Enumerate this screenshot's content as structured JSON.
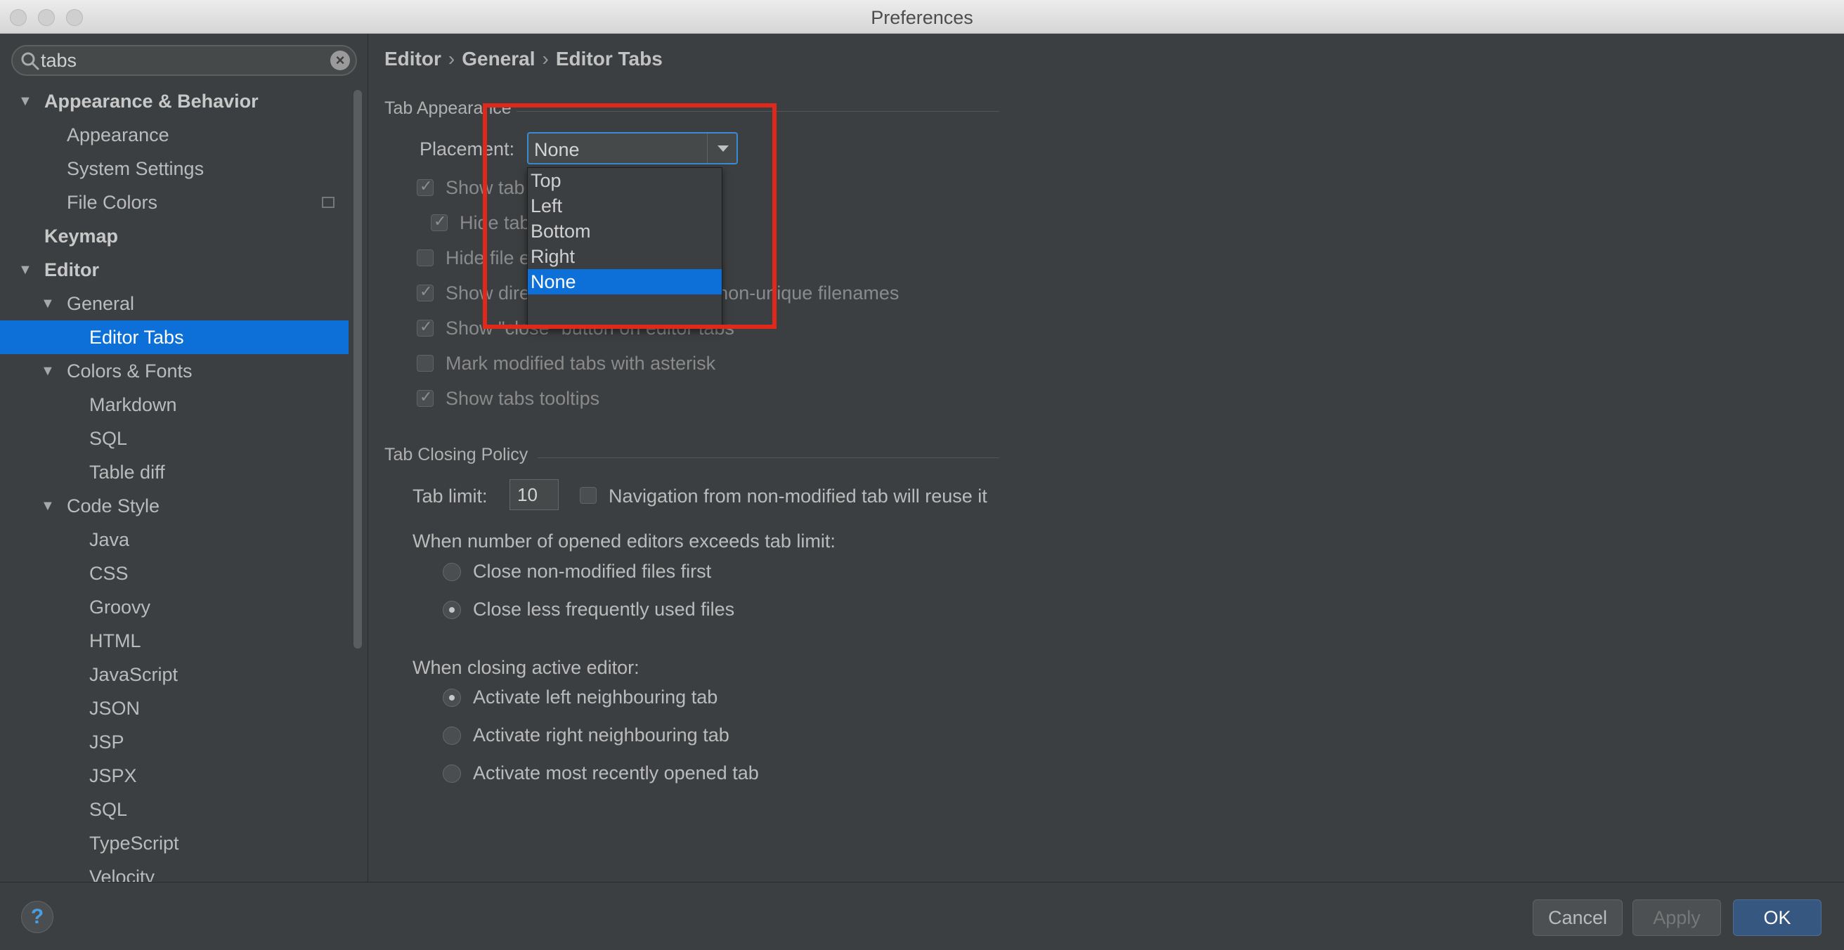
{
  "window": {
    "title": "Preferences"
  },
  "search": {
    "value": "tabs",
    "placeholder": ""
  },
  "sidebar": {
    "items": [
      {
        "label": "Appearance & Behavior",
        "level": 0,
        "bold": true,
        "expanded": true
      },
      {
        "label": "Appearance",
        "level": 1
      },
      {
        "label": "System Settings",
        "level": 1
      },
      {
        "label": "File Colors",
        "level": 1,
        "has_copy_icon": true
      },
      {
        "label": "Keymap",
        "level": 0,
        "bold": true
      },
      {
        "label": "Editor",
        "level": 0,
        "bold": true,
        "expanded": true
      },
      {
        "label": "General",
        "level": 1,
        "expanded": true
      },
      {
        "label": "Editor Tabs",
        "level": 2,
        "selected": true
      },
      {
        "label": "Colors & Fonts",
        "level": 1,
        "expanded": true
      },
      {
        "label": "Markdown",
        "level": 2
      },
      {
        "label": "SQL",
        "level": 2
      },
      {
        "label": "Table diff",
        "level": 2
      },
      {
        "label": "Code Style",
        "level": 1,
        "expanded": true
      },
      {
        "label": "Java",
        "level": 2
      },
      {
        "label": "CSS",
        "level": 2
      },
      {
        "label": "Groovy",
        "level": 2
      },
      {
        "label": "HTML",
        "level": 2
      },
      {
        "label": "JavaScript",
        "level": 2
      },
      {
        "label": "JSON",
        "level": 2
      },
      {
        "label": "JSP",
        "level": 2
      },
      {
        "label": "JSPX",
        "level": 2
      },
      {
        "label": "SQL",
        "level": 2
      },
      {
        "label": "TypeScript",
        "level": 2
      },
      {
        "label": "Velocity",
        "level": 2
      }
    ]
  },
  "breadcrumb": {
    "part1": "Editor",
    "part2": "General",
    "part3": "Editor Tabs",
    "separator": "›"
  },
  "tab_appearance": {
    "title": "Tab Appearance",
    "placement_label": "Placement:",
    "placement_value": "None",
    "placement_options": [
      "Top",
      "Left",
      "Bottom",
      "Right",
      "None"
    ],
    "checkboxes": {
      "show_tabs": {
        "label": "Show tab",
        "checked": true
      },
      "hide_tabs": {
        "label": "Hide tab",
        "checked": true
      },
      "hide_ext": {
        "label": "Hide file e",
        "checked": false
      },
      "show_dir": {
        "label": "Show directory in editor tabs for non-unique filenames",
        "checked": true
      },
      "show_close": {
        "label": "Show \"close\" button on editor tabs",
        "checked": true
      },
      "mark_modified": {
        "label": "Mark modified tabs with asterisk",
        "checked": false
      },
      "show_tooltips": {
        "label": "Show tabs tooltips",
        "checked": true
      }
    }
  },
  "tab_closing": {
    "title": "Tab Closing Policy",
    "tab_limit_label": "Tab limit:",
    "tab_limit_value": "10",
    "reuse_label": "Navigation from non-modified tab will reuse it",
    "exceeds_label": "When number of opened editors exceeds tab limit:",
    "close_non_modified": "Close non-modified files first",
    "close_less_frequent": "Close less frequently used files",
    "closing_active_label": "When closing active editor:",
    "activate_left": "Activate left neighbouring tab",
    "activate_right": "Activate right neighbouring tab",
    "activate_recent": "Activate most recently opened tab"
  },
  "footer": {
    "help": "?",
    "cancel": "Cancel",
    "apply": "Apply",
    "ok": "OK"
  },
  "colors": {
    "selection": "#0d6fd8",
    "highlight_box": "#e0281b",
    "primary_button": "#365880"
  }
}
